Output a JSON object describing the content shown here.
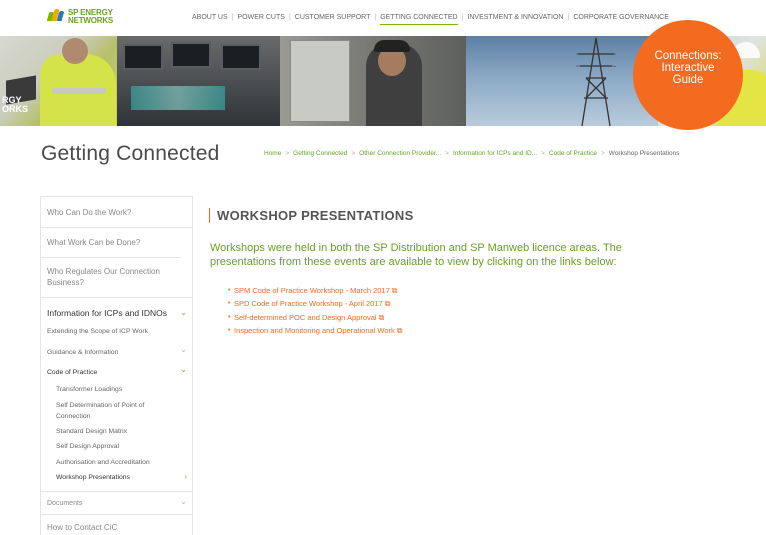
{
  "logo": {
    "line1": "SP ENERGY",
    "line2": "NETWORKS"
  },
  "topnav": [
    {
      "label": "ABOUT US"
    },
    {
      "label": "POWER CUTS"
    },
    {
      "label": "CUSTOMER SUPPORT"
    },
    {
      "label": "GETTING CONNECTED",
      "active": true
    },
    {
      "label": "INVESTMENT & INNOVATION"
    },
    {
      "label": "CORPORATE GOVERNANCE"
    }
  ],
  "hero": {
    "sign_text_1": "RGY",
    "sign_text_2": "ORKS",
    "cta": {
      "line1": "Connections:",
      "line2": "Interactive",
      "line3": "Guide"
    }
  },
  "page_title": "Getting Connected",
  "breadcrumb": [
    "Home",
    "Getting Connected",
    "Other Connection Provider...",
    "Information for ICPs and ID...",
    "Code of Practice",
    "Workshop Presentations"
  ],
  "sidebar": {
    "items": [
      "Who Can Do the Work?",
      "What Work Can be Done?",
      "Who Regulates Our Connection Business?",
      "Information for ICPs and IDNOs",
      "Documents",
      "How to Contact CiC"
    ],
    "sub": [
      "Extending the Scope of ICP Work",
      "Guidance & Information",
      "Code of Practice"
    ],
    "subsub": [
      "Transformer Loadings",
      "Self Determination of Point of Connection",
      "Standard Design Matrix",
      "Self Design Approval",
      "Authorisation and Accreditation",
      "Workshop Presentations"
    ]
  },
  "main": {
    "section_title": "WORKSHOP PRESENTATIONS",
    "intro": "Workshops were held in both the SP Distribution and SP Manweb licence areas. The presentations from these events are available to view by clicking on the links below:",
    "links": [
      "SPM Code of Practice Workshop - March 2017",
      "SPD Code of Practice Workshop - April 2017",
      "Self-determined POC and Design Approval",
      "Inspection and Monitoring and Operational Work"
    ]
  },
  "colors": {
    "accent_green": "#7ab800",
    "link_green": "#6aa121",
    "accent_orange": "#f46a1f"
  }
}
